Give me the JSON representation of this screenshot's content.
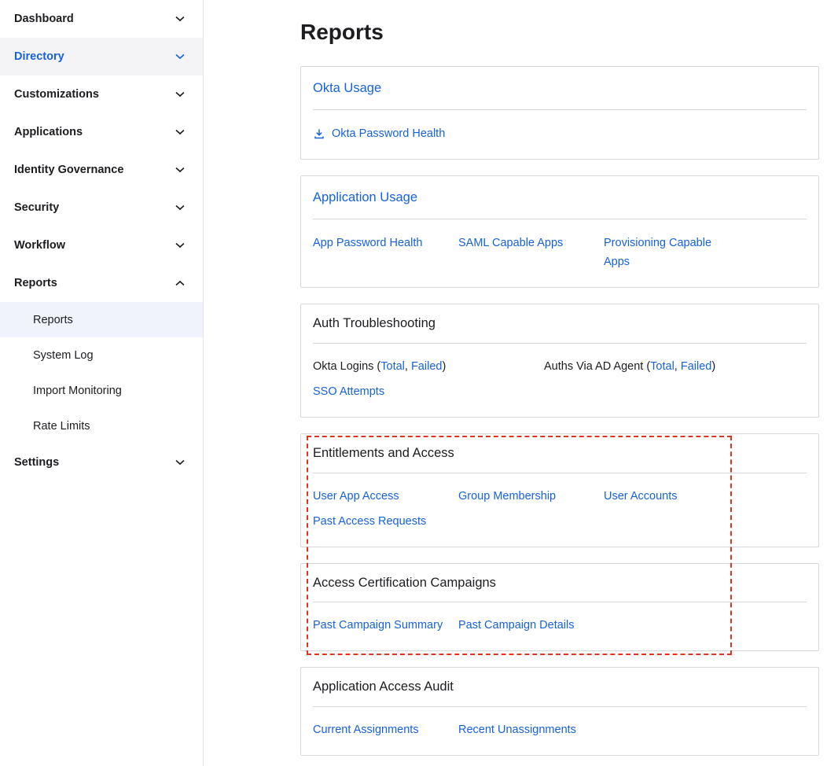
{
  "sidebar": {
    "items": [
      {
        "label": "Dashboard"
      },
      {
        "label": "Directory"
      },
      {
        "label": "Customizations"
      },
      {
        "label": "Applications"
      },
      {
        "label": "Identity Governance"
      },
      {
        "label": "Security"
      },
      {
        "label": "Workflow"
      },
      {
        "label": "Reports"
      },
      {
        "label": "Settings"
      }
    ],
    "reports_sub": [
      {
        "label": "Reports"
      },
      {
        "label": "System Log"
      },
      {
        "label": "Import Monitoring"
      },
      {
        "label": "Rate Limits"
      }
    ]
  },
  "page": {
    "title": "Reports"
  },
  "cards": {
    "okta_usage": {
      "title": "Okta Usage",
      "links": [
        "Okta Password Health"
      ]
    },
    "application_usage": {
      "title": "Application Usage",
      "links": [
        "App Password Health",
        "SAML Capable Apps",
        "Provisioning Capable",
        "Apps"
      ]
    },
    "auth_troubleshooting": {
      "title": "Auth Troubleshooting",
      "okta_logins": {
        "label": "Okta Logins (",
        "total": "Total",
        "comma": ", ",
        "failed": "Failed",
        "close": ")"
      },
      "auths_ad": {
        "label": "Auths Via AD Agent (",
        "total": "Total",
        "comma": ", ",
        "failed": "Failed",
        "close": ")"
      },
      "sso": "SSO Attempts"
    },
    "entitlements": {
      "title": "Entitlements and Access",
      "links": [
        "User App Access",
        "Group Membership",
        "User Accounts",
        "Past Access Requests"
      ]
    },
    "campaigns": {
      "title": "Access Certification Campaigns",
      "links": [
        "Past Campaign Summary",
        "Past Campaign Details"
      ]
    },
    "audit": {
      "title": "Application Access Audit",
      "links": [
        "Current Assignments",
        "Recent Unassignments"
      ]
    }
  },
  "colors": {
    "link": "#1662dd",
    "highlight": "#e0341e"
  }
}
